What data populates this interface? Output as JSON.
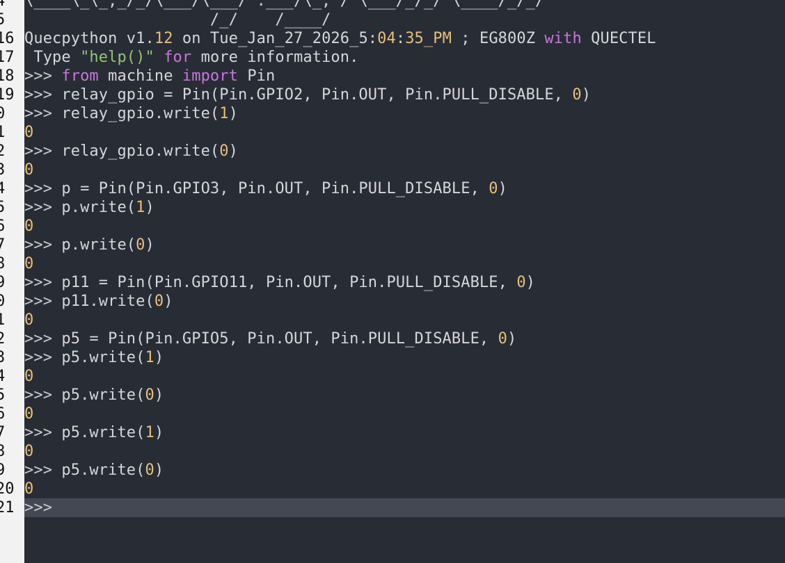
{
  "app": {
    "gutter_numbers": [
      "4",
      "5",
      "16",
      "17",
      "18",
      "19",
      "0",
      "1",
      "2",
      "3",
      "4",
      "5",
      "6",
      "7",
      "8",
      "9",
      "0",
      "1",
      "2",
      "3",
      "4",
      "5",
      "6",
      "7",
      "8",
      "9",
      "20",
      "21"
    ],
    "colors": {
      "background": "#282c34",
      "gutter": "#f2f2f2",
      "active_line": "#434853",
      "keyword": "#c678dd",
      "string": "#98c379",
      "number": "#e5c07b",
      "text": "#d4d7dc"
    },
    "lines": [
      {
        "segs": [
          {
            "t": "\\____\\_\\_,_/_/\\___/\\___/ .___/\\_, / \\___/_/_/ \\____/_/_/",
            "c": "plain"
          }
        ]
      },
      {
        "segs": [
          {
            "t": "                    /_/    /____/",
            "c": "plain"
          }
        ]
      },
      {
        "segs": [
          {
            "t": "Quecpython v1.",
            "c": "plain"
          },
          {
            "t": "12",
            "c": "num"
          },
          {
            "t": " on Tue_Jan_27_2026_5:",
            "c": "plain"
          },
          {
            "t": "04",
            "c": "num"
          },
          {
            "t": ":",
            "c": "plain"
          },
          {
            "t": "35",
            "c": "num"
          },
          {
            "t": "_PM",
            "c": "num"
          },
          {
            "t": " ; EG800Z ",
            "c": "plain"
          },
          {
            "t": "with",
            "c": "kw"
          },
          {
            "t": " QUECTEL",
            "c": "plain"
          }
        ]
      },
      {
        "segs": [
          {
            "t": " Type ",
            "c": "plain"
          },
          {
            "t": "\"help()\"",
            "c": "str"
          },
          {
            "t": " ",
            "c": "plain"
          },
          {
            "t": "for",
            "c": "kw"
          },
          {
            "t": " more information.",
            "c": "plain"
          }
        ]
      },
      {
        "segs": [
          {
            "t": ">>> ",
            "c": "prompt"
          },
          {
            "t": "from",
            "c": "kw"
          },
          {
            "t": " machine ",
            "c": "plain"
          },
          {
            "t": "import",
            "c": "kw"
          },
          {
            "t": " Pin",
            "c": "plain"
          }
        ]
      },
      {
        "segs": [
          {
            "t": ">>> ",
            "c": "prompt"
          },
          {
            "t": "relay_gpio = Pin(Pin.GPIO2, Pin.OUT, Pin.PULL_DISABLE, ",
            "c": "plain"
          },
          {
            "t": "0",
            "c": "num"
          },
          {
            "t": ")",
            "c": "plain"
          }
        ]
      },
      {
        "segs": [
          {
            "t": ">>> ",
            "c": "prompt"
          },
          {
            "t": "relay_gpio.write(",
            "c": "plain"
          },
          {
            "t": "1",
            "c": "num"
          },
          {
            "t": ")",
            "c": "plain"
          }
        ]
      },
      {
        "segs": [
          {
            "t": "0",
            "c": "num"
          }
        ]
      },
      {
        "segs": [
          {
            "t": ">>> ",
            "c": "prompt"
          },
          {
            "t": "relay_gpio.write(",
            "c": "plain"
          },
          {
            "t": "0",
            "c": "num"
          },
          {
            "t": ")",
            "c": "plain"
          }
        ]
      },
      {
        "segs": [
          {
            "t": "0",
            "c": "num"
          }
        ]
      },
      {
        "segs": [
          {
            "t": ">>> ",
            "c": "prompt"
          },
          {
            "t": "p = Pin(Pin.GPIO3, Pin.OUT, Pin.PULL_DISABLE, ",
            "c": "plain"
          },
          {
            "t": "0",
            "c": "num"
          },
          {
            "t": ")",
            "c": "plain"
          }
        ]
      },
      {
        "segs": [
          {
            "t": ">>> ",
            "c": "prompt"
          },
          {
            "t": "p.write(",
            "c": "plain"
          },
          {
            "t": "1",
            "c": "num"
          },
          {
            "t": ")",
            "c": "plain"
          }
        ]
      },
      {
        "segs": [
          {
            "t": "0",
            "c": "num"
          }
        ]
      },
      {
        "segs": [
          {
            "t": ">>> ",
            "c": "prompt"
          },
          {
            "t": "p.write(",
            "c": "plain"
          },
          {
            "t": "0",
            "c": "num"
          },
          {
            "t": ")",
            "c": "plain"
          }
        ]
      },
      {
        "segs": [
          {
            "t": "0",
            "c": "num"
          }
        ]
      },
      {
        "segs": [
          {
            "t": ">>> ",
            "c": "prompt"
          },
          {
            "t": "p11 = Pin(Pin.GPIO11, Pin.OUT, Pin.PULL_DISABLE, ",
            "c": "plain"
          },
          {
            "t": "0",
            "c": "num"
          },
          {
            "t": ")",
            "c": "plain"
          }
        ]
      },
      {
        "segs": [
          {
            "t": ">>> ",
            "c": "prompt"
          },
          {
            "t": "p11.write(",
            "c": "plain"
          },
          {
            "t": "0",
            "c": "num"
          },
          {
            "t": ")",
            "c": "plain"
          }
        ]
      },
      {
        "segs": [
          {
            "t": "0",
            "c": "num"
          }
        ]
      },
      {
        "segs": [
          {
            "t": ">>> ",
            "c": "prompt"
          },
          {
            "t": "p5 = Pin(Pin.GPIO5, Pin.OUT, Pin.PULL_DISABLE, ",
            "c": "plain"
          },
          {
            "t": "0",
            "c": "num"
          },
          {
            "t": ")",
            "c": "plain"
          }
        ]
      },
      {
        "segs": [
          {
            "t": ">>> ",
            "c": "prompt"
          },
          {
            "t": "p5.write(",
            "c": "plain"
          },
          {
            "t": "1",
            "c": "num"
          },
          {
            "t": ")",
            "c": "plain"
          }
        ]
      },
      {
        "segs": [
          {
            "t": "0",
            "c": "num"
          }
        ]
      },
      {
        "segs": [
          {
            "t": ">>> ",
            "c": "prompt"
          },
          {
            "t": "p5.write(",
            "c": "plain"
          },
          {
            "t": "0",
            "c": "num"
          },
          {
            "t": ")",
            "c": "plain"
          }
        ]
      },
      {
        "segs": [
          {
            "t": "0",
            "c": "num"
          }
        ]
      },
      {
        "segs": [
          {
            "t": ">>> ",
            "c": "prompt"
          },
          {
            "t": "p5.write(",
            "c": "plain"
          },
          {
            "t": "1",
            "c": "num"
          },
          {
            "t": ")",
            "c": "plain"
          }
        ]
      },
      {
        "segs": [
          {
            "t": "0",
            "c": "num"
          }
        ]
      },
      {
        "segs": [
          {
            "t": ">>> ",
            "c": "prompt"
          },
          {
            "t": "p5.write(",
            "c": "plain"
          },
          {
            "t": "0",
            "c": "num"
          },
          {
            "t": ")",
            "c": "plain"
          }
        ]
      },
      {
        "segs": [
          {
            "t": "0",
            "c": "num"
          }
        ]
      },
      {
        "segs": [
          {
            "t": ">>> ",
            "c": "prompt"
          }
        ],
        "active": true
      }
    ]
  }
}
